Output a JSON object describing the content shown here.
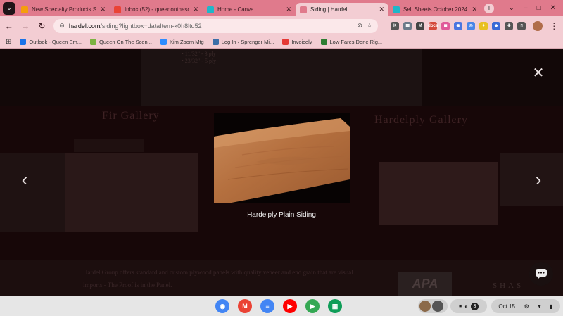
{
  "browser": {
    "tabs": [
      {
        "label": "New Specialty Products Sell",
        "favicon_color": "#f59e0b",
        "active": false
      },
      {
        "label": "Inbox (52) - queenonthescen",
        "favicon_color": "#ea4335",
        "active": false
      },
      {
        "label": "Home - Canva",
        "favicon_color": "#1fb6c9",
        "active": false
      },
      {
        "label": "Siding | Hardel",
        "favicon_color": "#e07a8c",
        "active": true
      },
      {
        "label": "Sell Sheets October 2024 Dr",
        "favicon_color": "#1fb6c9",
        "active": false
      }
    ],
    "new_tab_symbol": "+",
    "window_controls": [
      "⌄",
      "–",
      "□",
      "✕"
    ],
    "url_host": "hardel.com",
    "url_path": "/siding?lightbox=dataItem-k0h8ltd52",
    "extensions": [
      {
        "name": "k-extension-icon",
        "color": "#555",
        "text": "K"
      },
      {
        "name": "grid-extension-icon",
        "color": "#6c7a89",
        "text": "▦"
      },
      {
        "name": "m-extension-icon",
        "color": "#444",
        "text": "M"
      },
      {
        "name": "docs-extension-icon",
        "color": "#d54a3d",
        "text": "docs"
      },
      {
        "name": "pink-extension-icon",
        "color": "#e05a9a",
        "text": "◼"
      },
      {
        "name": "blue-circle-extension-icon",
        "color": "#4a76e0",
        "text": "◉"
      },
      {
        "name": "chrome-extension-icon",
        "color": "#4a86e8",
        "text": "◎"
      },
      {
        "name": "lightbulb-extension-icon",
        "color": "#e8c020",
        "text": "✦"
      },
      {
        "name": "blue-extension-icon",
        "color": "#3a6ad6",
        "text": "◆"
      },
      {
        "name": "puzzle-extension-icon",
        "color": "#555",
        "text": "✚"
      },
      {
        "name": "sidepanel-extension-icon",
        "color": "#555",
        "text": "▯"
      }
    ],
    "bookmarks": [
      {
        "label": "Outlook - Queen Em...",
        "color": "#1a73e8"
      },
      {
        "label": "Queen On The Scen...",
        "color": "#7cb342"
      },
      {
        "label": "Kim Zoom Mtg",
        "color": "#2d8cff"
      },
      {
        "label": "Log In ‹ Sprenger Mi...",
        "color": "#3c6ea8"
      },
      {
        "label": "Invoicely",
        "color": "#e53935"
      },
      {
        "label": "Low Fares Done Rig...",
        "color": "#2e7d32"
      }
    ]
  },
  "page": {
    "bg_list": [
      "• 11/32\" - 3 ply",
      "• 23/32\" - 5 ply"
    ],
    "fir_gallery": "Fir Gallery",
    "hardelply_gallery": "Hardelply Gallery",
    "bg_paragraph": "Hardel Group offers standard and custom plywood panels with quality veneer and end grain that are visual imports - The Proof is in the Panel.",
    "apa_logo": "APA",
    "shas_text": "SHAS"
  },
  "lightbox": {
    "close_symbol": "✕",
    "prev_symbol": "‹",
    "next_symbol": "›",
    "caption": "Hardelply Plain Siding"
  },
  "shelf": {
    "apps": [
      {
        "name": "chrome-app-icon",
        "color": "#4285f4",
        "text": "◉"
      },
      {
        "name": "gmail-app-icon",
        "color": "#ea4335",
        "text": "M"
      },
      {
        "name": "docs-app-icon",
        "color": "#4285f4",
        "text": "≡"
      },
      {
        "name": "youtube-app-icon",
        "color": "#ff0000",
        "text": "▶"
      },
      {
        "name": "play-store-app-icon",
        "color": "#34a853",
        "text": "▶"
      },
      {
        "name": "sheets-app-icon",
        "color": "#0f9d58",
        "text": "▦"
      }
    ],
    "tray_badge": "3",
    "status_time": "Oct 15",
    "status_icons": [
      "⚙",
      "▾",
      "▮"
    ]
  }
}
